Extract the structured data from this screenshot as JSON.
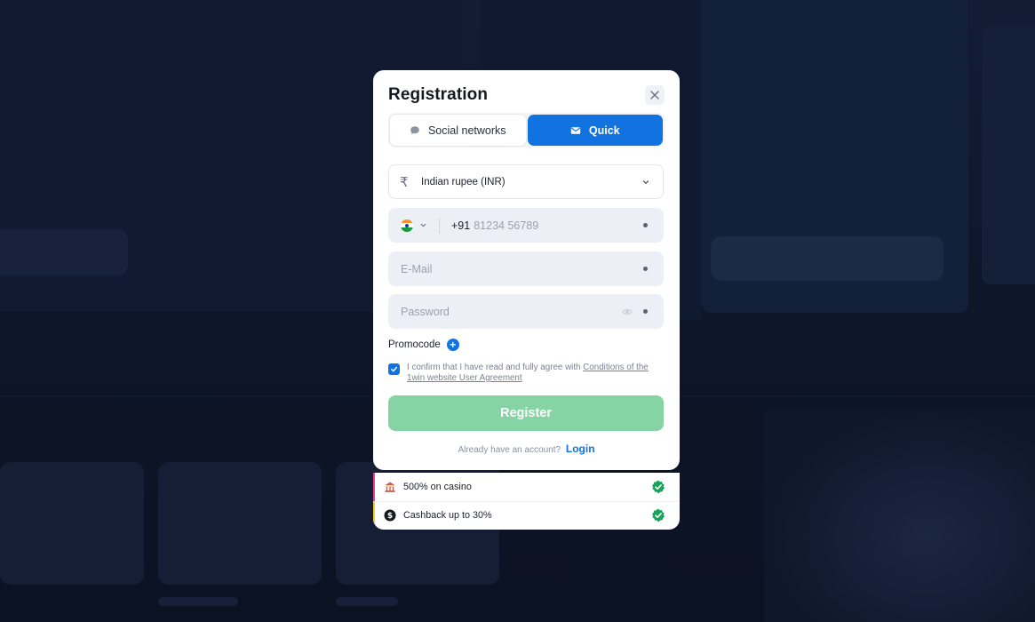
{
  "modal": {
    "title": "Registration",
    "tabs": [
      {
        "label": "Social networks"
      },
      {
        "label": "Quick"
      }
    ],
    "currency": {
      "symbol": "₹",
      "label": "Indian rupee (INR)"
    },
    "phone": {
      "dial_code": "+91",
      "placeholder": "81234 56789"
    },
    "email": {
      "placeholder": "E-Mail"
    },
    "password": {
      "placeholder": "Password"
    },
    "promocode": {
      "label": "Promocode",
      "plus": "+"
    },
    "agreement": {
      "text": "I confirm that I have read and fully agree with ",
      "link": "Conditions of the 1win website User Agreement"
    },
    "register_label": "Register",
    "login_prompt": "Already have an account?",
    "login_label": "Login"
  },
  "bonuses": [
    {
      "label": "500% on casino",
      "accent": "#e83e9c"
    },
    {
      "label": "Cashback up to 30%",
      "accent": "#f2d024"
    }
  ],
  "colors": {
    "primary": "#1273e0",
    "register_disabled": "#86d3a3",
    "success": "#19a45a"
  }
}
